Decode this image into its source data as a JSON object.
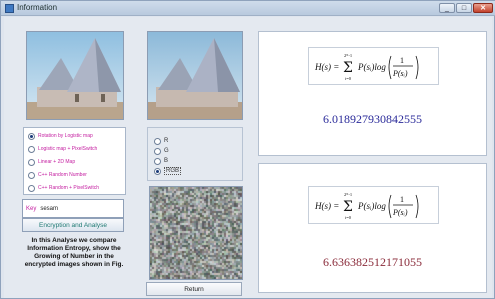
{
  "window": {
    "title": "Information"
  },
  "algorithms": [
    {
      "label": "Rotation by Logistic map",
      "checked": true
    },
    {
      "label": "Logistic map + PixelSwitch",
      "checked": false
    },
    {
      "label": "Linear + 2D Map",
      "checked": false
    },
    {
      "label": "C++ Random Number",
      "checked": false
    },
    {
      "label": "C++ Random + PixelSwitch",
      "checked": false
    }
  ],
  "channels": [
    {
      "label": "R",
      "checked": false
    },
    {
      "label": "G",
      "checked": false
    },
    {
      "label": "B",
      "checked": false
    },
    {
      "label": "RGB",
      "checked": true
    }
  ],
  "key": {
    "label": "Key",
    "value": "sesam"
  },
  "encrypt_button": "Encryption and Analyse",
  "description": "In this Analyse we compare Information Entropy, show the Growing of Number in the encrypted images shown in Fig.",
  "return_button": "Return",
  "entropy_panels": [
    {
      "formula": "H(s) = Σ P(sᵢ) log(1/P(sᵢ))",
      "value": "6.018927930842555"
    },
    {
      "formula": "H(s) = Σ P(sᵢ) log(1/P(sᵢ))",
      "value": "6.636382512171055"
    }
  ],
  "colors": {
    "accent_magenta": "#c41ea0",
    "entropy_blue": "#2b2b9a",
    "entropy_red": "#8a2b3a"
  }
}
